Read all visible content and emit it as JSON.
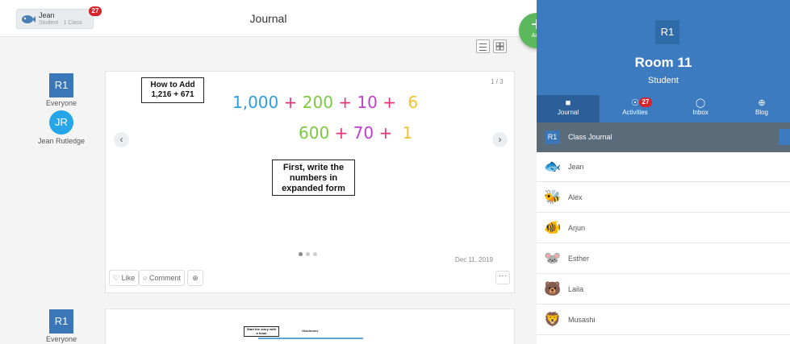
{
  "app": {
    "title": "Journal"
  },
  "user_chip": {
    "name": "Jean",
    "subtitle": "Student · 1 Class",
    "notification_count": "27"
  },
  "feed": {
    "posts": [
      {
        "avatar_initials": "R1",
        "audience_label": "Everyone",
        "author_initials": "JR",
        "author_name": "Jean Rutledge",
        "page_indicator": "1 / 3",
        "box_title_line1": "How to Add",
        "box_title_line2": "1,216 + 671",
        "handwriting_line1": [
          "1,000",
          "+",
          "200",
          "+",
          "10",
          "+",
          "6"
        ],
        "handwriting_line2": [
          "600",
          "+",
          "70",
          "+",
          "1"
        ],
        "note_line1": "First, write the",
        "note_line2": "numbers in",
        "note_line3": "expanded form",
        "date": "Dec 11, 2019",
        "like_label": "Like",
        "comment_label": "Comment",
        "more_label": "···",
        "prev_label": "‹",
        "next_label": "›"
      },
      {
        "avatar_initials": "R1",
        "audience_label": "Everyone",
        "box_label_line1": "Start the story with",
        "box_label_line2": "a hook",
        "heading": "Headnotes"
      }
    ]
  },
  "fab": {
    "label": "Add",
    "symbol": "+"
  },
  "panel": {
    "avatar": "R1",
    "room_name": "Room 11",
    "role": "Student",
    "tabs": [
      {
        "label": "Journal",
        "icon": "book-icon",
        "glyph": "■"
      },
      {
        "label": "Activities",
        "icon": "lightbulb-icon",
        "glyph": "☉",
        "badge": "27"
      },
      {
        "label": "Inbox",
        "icon": "chat-icon",
        "glyph": "◯"
      },
      {
        "label": "Blog",
        "icon": "globe-icon",
        "glyph": "⊕"
      }
    ],
    "class_row": {
      "initials": "R1",
      "label": "Class Journal"
    },
    "students": [
      {
        "name": "Jean",
        "icon": "fish-icon",
        "glyph": "🐟"
      },
      {
        "name": "Alex",
        "icon": "bee-icon",
        "glyph": "🐝"
      },
      {
        "name": "Arjun",
        "icon": "tropical-fish-icon",
        "glyph": "🐠"
      },
      {
        "name": "Esther",
        "icon": "mouse-icon",
        "glyph": "🐭"
      },
      {
        "name": "Laila",
        "icon": "bear-icon",
        "glyph": "🐻"
      },
      {
        "name": "Musashi",
        "icon": "lion-icon",
        "glyph": "🦁"
      }
    ]
  },
  "colors": {
    "accent": "#3c7bc0",
    "accent_dark": "#2c5f97",
    "fab_green": "#5cb85c",
    "badge_red": "#d8232a",
    "handwriting_blue": "#2d9ee0",
    "handwriting_green": "#7ac943",
    "handwriting_purple": "#c03fd0",
    "handwriting_yellow": "#f2c12e",
    "handwriting_pink": "#e8327a"
  }
}
